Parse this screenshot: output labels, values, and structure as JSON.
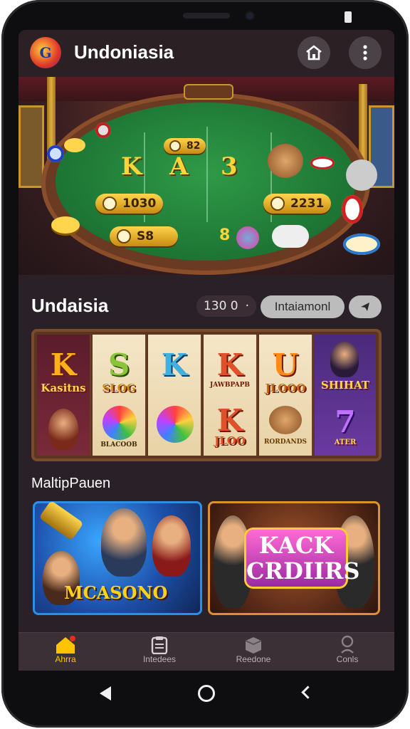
{
  "app": {
    "title": "Undoniasia"
  },
  "hero": {
    "pill_left": "1030",
    "pill_right": "2231",
    "pill_bottom": "S8",
    "top_chip_left": "82",
    "table_letters": [
      "K",
      "A",
      "3"
    ],
    "small_number": "8"
  },
  "section": {
    "title": "Undaisia",
    "counter": "130 0",
    "counter_sep": "·",
    "button_label": "Intaiamonl"
  },
  "reels": [
    {
      "top": "K",
      "top_caption": "Kasitns",
      "bottom_caption": ""
    },
    {
      "top": "S",
      "top_caption": "SLOG",
      "bottom_caption": "BLACOOB"
    },
    {
      "top": "K",
      "top_caption": "",
      "bottom_caption": ""
    },
    {
      "top": "K",
      "top_caption": "JAWBPAPB",
      "bottom_caption": "JLOO"
    },
    {
      "top": "U",
      "top_caption": "JLOOO",
      "bottom_caption": "RORDANDS"
    },
    {
      "top": "",
      "top_caption": "SHIHAT",
      "bottom_caption": "ATER"
    }
  ],
  "multiplayer": {
    "title": "MaltipPauen",
    "games": [
      {
        "title": "MCASONO"
      },
      {
        "title": "KACK CRDIIRS"
      }
    ]
  },
  "bottom_nav": [
    {
      "label": "Ahrra",
      "icon": "home-icon",
      "active": true
    },
    {
      "label": "Intedees",
      "icon": "clipboard-icon",
      "active": false
    },
    {
      "label": "Reedone",
      "icon": "box-icon",
      "active": false
    },
    {
      "label": "Conls",
      "icon": "person-icon",
      "active": false
    }
  ],
  "colors": {
    "accent": "#ffc400",
    "background": "#2a2128",
    "felt": "#1d7434"
  }
}
